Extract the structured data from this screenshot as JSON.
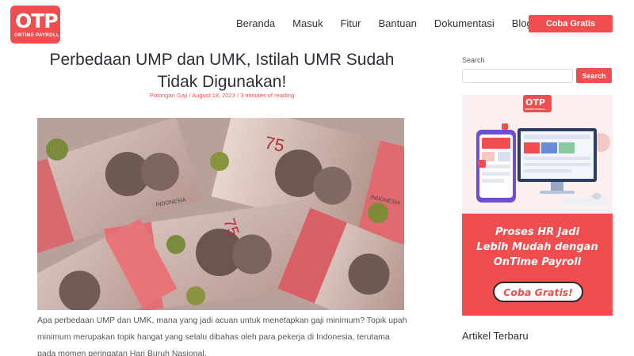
{
  "header": {
    "logo_text": "OTP",
    "logo_subtext": "ONTIME PAYROLL",
    "nav": [
      {
        "label": "Beranda"
      },
      {
        "label": "Masuk"
      },
      {
        "label": "Fitur"
      },
      {
        "label": "Bantuan"
      },
      {
        "label": "Dokumentasi"
      },
      {
        "label": "Blog"
      }
    ],
    "cta_label": "Coba Gratis"
  },
  "article": {
    "title": "Perbedaan UMP dan UMK, Istilah UMR Sudah Tidak Digunakan!",
    "meta": {
      "category": "Potongan Gaji",
      "date": "August 18, 2023",
      "reading_time": "3 minutes of reading"
    },
    "hero_image": {
      "banknote_value": "75",
      "banknote_text": "INDONESIA"
    },
    "intro": "Apa perbedaan UMP dan UMK, mana yang jadi acuan untuk menetapkan gaji minimum? Topik upah minimum merupakan topik hangat yang selalu dibahas oleh para pekerja di Indonesia, terutama pada momen peringatan Hari Buruh Nasional."
  },
  "sidebar": {
    "search_label": "Search",
    "search_value": "",
    "search_button": "Search",
    "ad": {
      "logo_text": "OTP",
      "logo_subtext": "ONTIME PAYROLL",
      "headline": [
        "Proses HR Jadi",
        "Lebih Mudah dengan",
        "OnTime Payroll"
      ],
      "cta": "Coba Gratis!"
    },
    "recent_title": "Artikel Terbaru"
  },
  "colors": {
    "brand_red": "#f04e4e",
    "text_dark": "#2c2f36"
  }
}
